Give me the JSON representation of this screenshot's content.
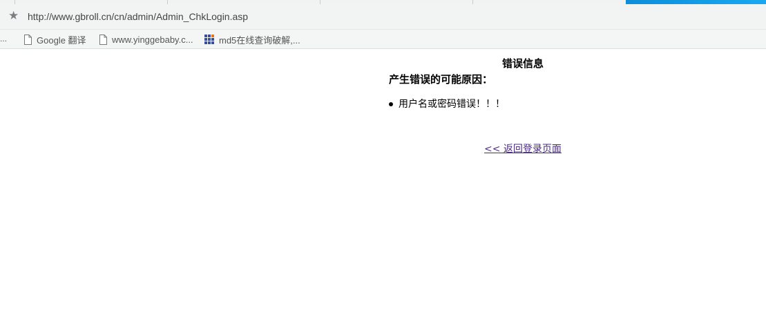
{
  "browser": {
    "url": "http://www.gbroll.cn/cn/admin/Admin_ChkLogin.asp",
    "star_icon": "star-icon",
    "accent_color": "#1ba1e2"
  },
  "bookmarks": {
    "overflow": "...",
    "items": [
      {
        "label": "Google 翻译",
        "icon": "page-icon"
      },
      {
        "label": "www.yinggebaby.c...",
        "icon": "page-icon"
      },
      {
        "label": "md5在线查询破解,...",
        "icon": "grid-icon"
      }
    ]
  },
  "page": {
    "title": "错误信息",
    "reason_heading": "产生错误的可能原因：",
    "errors": [
      "用户名或密码错误！！！"
    ],
    "back_link": "<< 返回登录页面",
    "link_color": "#4a2a83"
  }
}
